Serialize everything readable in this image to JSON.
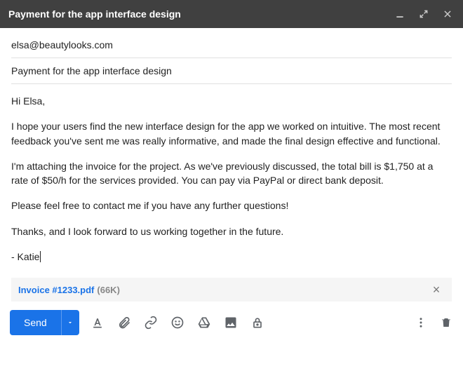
{
  "window": {
    "title": "Payment for the app interface design"
  },
  "compose": {
    "to": "elsa@beautylooks.com",
    "subject": "Payment for the app interface design",
    "body": {
      "greeting": "Hi Elsa,",
      "p1": "I hope your users find the new interface design for the app we worked on intuitive. The most recent feedback you've sent me was really informative, and made the final design effective and functional.",
      "p2": "I'm attaching the invoice for the project. As we've previously discussed, the total bill is $1,750 at a rate of $50/h for the services provided. You can pay via PayPal or direct bank deposit.",
      "p3": "Please feel free to contact me if you have any further questions!",
      "p4": "Thanks, and I look forward to us working together in the future.",
      "signoff": "- Katie"
    }
  },
  "attachment": {
    "filename": "Invoice #1233.pdf",
    "size": "(66K)"
  },
  "toolbar": {
    "send_label": "Send"
  }
}
